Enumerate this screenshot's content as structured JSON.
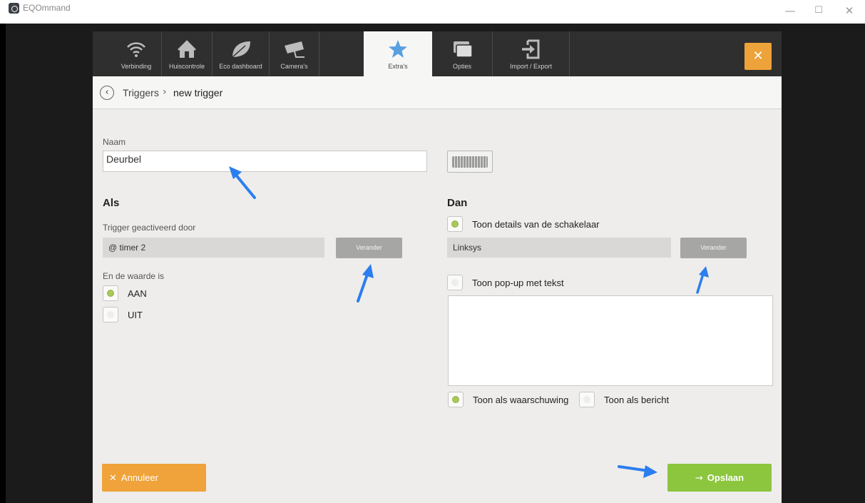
{
  "window": {
    "title": "EQOmmand",
    "minimize_label": "—",
    "maximize_label": "☐",
    "close_label": "✕"
  },
  "tabs": [
    {
      "label": "Verbinding",
      "icon": "wifi-icon"
    },
    {
      "label": "Huiscontrole",
      "icon": "house-icon"
    },
    {
      "label": "Eco dashboard",
      "icon": "leaf-icon"
    },
    {
      "label": "Camera's",
      "icon": "camera-icon"
    },
    {
      "label": "Extra's",
      "icon": "star-icon",
      "active": true
    },
    {
      "label": "Opties",
      "icon": "windows-icon"
    },
    {
      "label": "Import / Export",
      "icon": "import-export-icon"
    }
  ],
  "close_button": {
    "label": "✕"
  },
  "breadcrumb": {
    "back": "‹",
    "root": "Triggers",
    "separator": "›",
    "current": "new trigger"
  },
  "form": {
    "name_label": "Naam",
    "name_value": "Deurbel",
    "als": {
      "heading": "Als",
      "trigger_label": "Trigger geactiveerd door",
      "trigger_value": "@ timer 2",
      "change_button": "Verander",
      "value_label": "En de waarde is",
      "options": [
        {
          "label": "AAN",
          "selected": true
        },
        {
          "label": "UIT",
          "selected": false
        }
      ]
    },
    "dan": {
      "heading": "Dan",
      "show_switch_label": "Toon details van de schakelaar",
      "show_switch_selected": true,
      "switch_value": "Linksys",
      "change_button": "Verander",
      "popup_label": "Toon pop-up met tekst",
      "popup_selected": false,
      "popup_text": "",
      "warning_label": "Toon als waarschuwing",
      "warning_selected": true,
      "message_label": "Toon als bericht",
      "message_selected": false
    }
  },
  "footer": {
    "cancel": "Annuleer",
    "cancel_icon": "✕",
    "save": "Opslaan",
    "save_icon": "→"
  },
  "colors": {
    "accent_orange": "#f0a33a",
    "save_green": "#8cc63e",
    "radio_on": "#a8c85a",
    "annotation_arrow": "#2b7ef0"
  }
}
